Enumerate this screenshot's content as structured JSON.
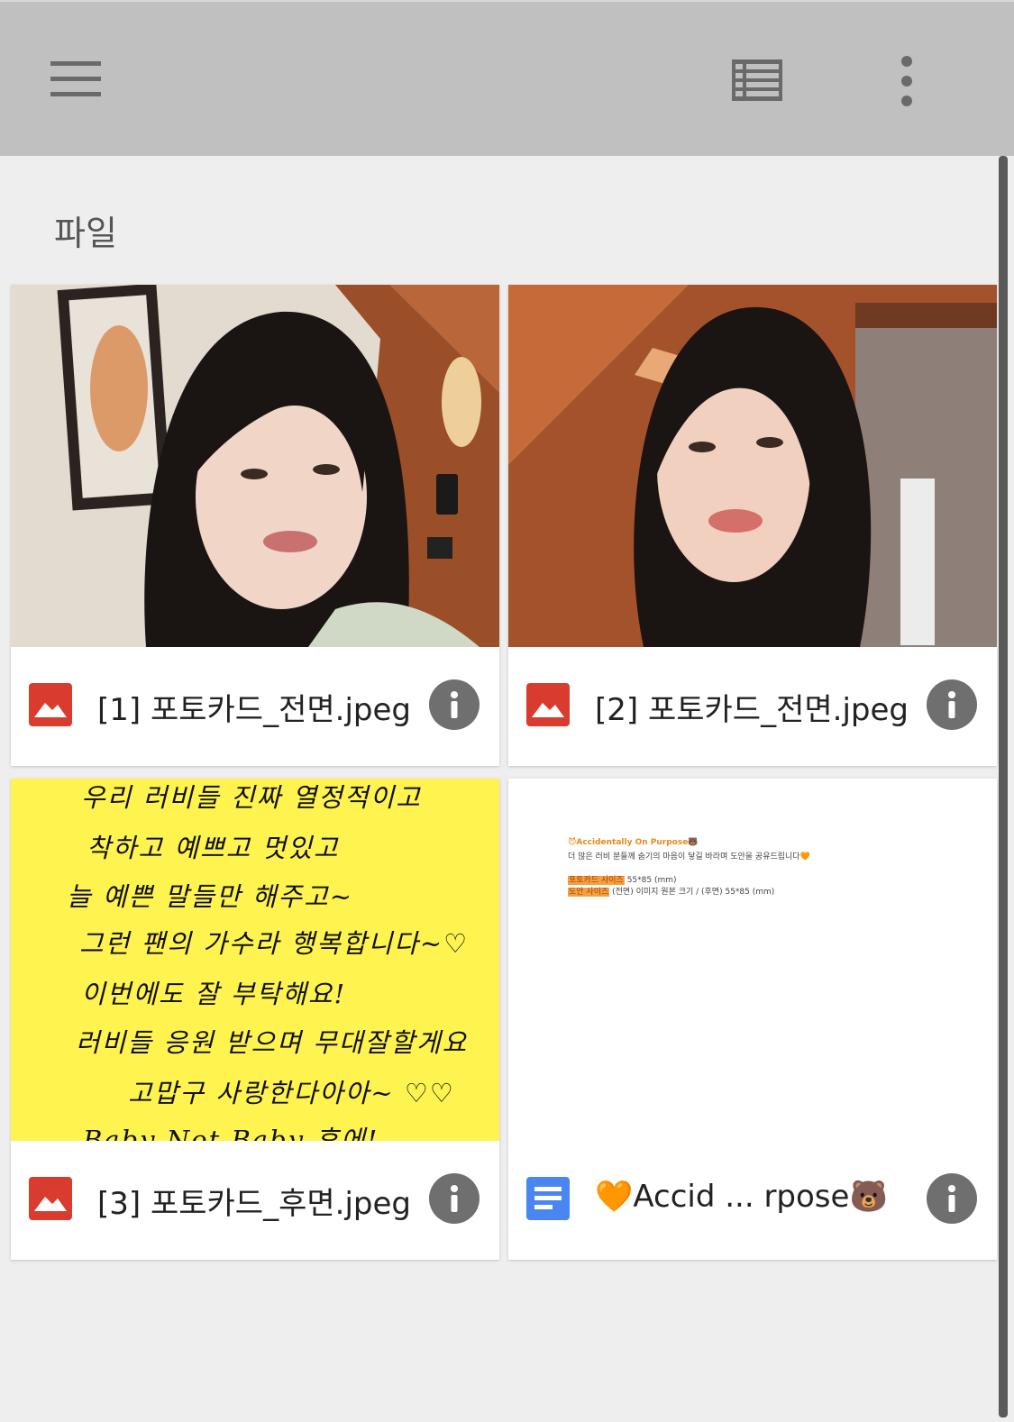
{
  "toolbar": {
    "menu_icon": "hamburger-menu-icon",
    "list_view_icon": "list-view-icon",
    "more_icon": "more-vertical-icon"
  },
  "section": {
    "title": "파일"
  },
  "files": [
    {
      "name": "[1] 포토카드_전면.jpeg",
      "type_icon": "image-file-icon",
      "type_color": "#d93b2e"
    },
    {
      "name": "[2] 포토카드_전면.jpeg",
      "type_icon": "image-file-icon",
      "type_color": "#d93b2e"
    },
    {
      "name": "[3] 포토카드_후면.jpeg",
      "type_icon": "image-file-icon",
      "type_color": "#d93b2e"
    },
    {
      "name": "🧡Accid ... rpose🐻",
      "type_icon": "document-file-icon",
      "type_color": "#4a86f0"
    }
  ],
  "doc_preview": {
    "title": "😈Accidentally On Purpose🐻",
    "line1": "더 많은 러비 분들께 숨기의 마음이 닿길 바라며 도안을 공유드립니다🧡",
    "size_label": "포토카드 사이즈",
    "size_value": "55*85 (mm)",
    "design_label": "도안 사이즈",
    "design_value": "(전면) 이미지 원본 크기 / (후면) 55*85 (mm)"
  },
  "handwritten_note": [
    "우리 러비들 진짜 열정적이고",
    "착하고 예쁘고 멋있고",
    "늘 예쁜 말들만 해주고~",
    "그런 팬의 가수라 행복합니다~♡",
    "이번에도 잘 부탁해요!",
    "러비들 응원 받으며 무대잘할게요",
    "고맙구 사랑한다아아~ ♡♡",
    "Baby Not Baby 후에!"
  ],
  "colors": {
    "toolbar_bg": "#c0c0c0",
    "page_bg": "#eeeeee",
    "note_bg": "#fff44f"
  }
}
